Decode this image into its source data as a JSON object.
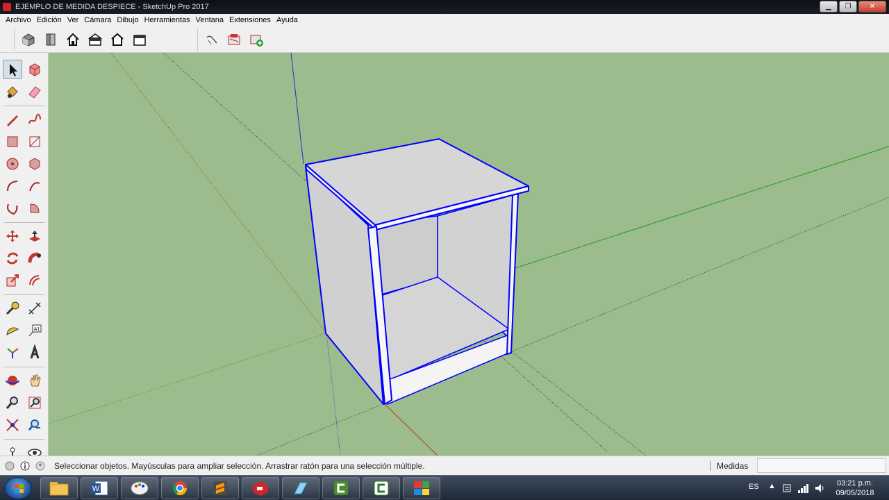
{
  "window": {
    "title": "EJEMPLO DE MEDIDA DESPIECE - SketchUp Pro 2017",
    "controls": {
      "minimize": "▁",
      "maximize": "❐",
      "close": "✕"
    }
  },
  "menu": {
    "items": [
      "Archivo",
      "Edición",
      "Ver",
      "Cámara",
      "Dibujo",
      "Herramientas",
      "Ventana",
      "Extensiones",
      "Ayuda"
    ]
  },
  "toolbar_top": {
    "icons": [
      "iso-view-icon",
      "top-view-icon",
      "home-view-icon",
      "front-view-icon",
      "right-view-icon",
      "back-view-icon",
      "section-plane-icon",
      "warehouse-icon",
      "extension-warehouse-icon"
    ]
  },
  "toolbar_left": {
    "icons": [
      "select-icon",
      "make-component-icon",
      "paint-bucket-icon",
      "eraser-icon",
      "pencil-line-icon",
      "freehand-icon",
      "rectangle-icon",
      "rotated-rectangle-icon",
      "circle-icon",
      "polygon-icon",
      "arc-icon",
      "two-point-arc-icon",
      "three-point-arc-icon",
      "pie-icon",
      "move-icon",
      "push-pull-icon",
      "rotate-icon",
      "follow-me-icon",
      "scale-icon",
      "offset-icon",
      "tape-measure-icon",
      "dimension-icon",
      "protractor-icon",
      "text-icon",
      "axes-icon",
      "3d-text-icon",
      "orbit-icon",
      "pan-icon",
      "zoom-icon",
      "zoom-window-icon",
      "zoom-extents-icon",
      "previous-view-icon",
      "position-camera-icon",
      "look-around-icon"
    ],
    "selected": "select-icon"
  },
  "status": {
    "message": "Seleccionar objetos. Mayúsculas para ampliar selección. Arrastrar ratón para una selección múltiple.",
    "measure_label": "Medidas",
    "measure_value": ""
  },
  "taskbar": {
    "apps": [
      "file-explorer-icon",
      "word-icon",
      "paint-icon",
      "chrome-icon",
      "sublime-icon",
      "sketchup-icon",
      "unknown-app-icon",
      "camtasia-icon",
      "camtasia-recorder-icon",
      "colorful-app-icon"
    ],
    "language": "ES",
    "time": "03:21 p.m.",
    "date": "09/05/2018"
  },
  "colors": {
    "viewport_bg": "#9cbc8e",
    "selection": "#0000ff",
    "axis_red": "#c0392b",
    "axis_green": "#1f9b1f",
    "axis_blue": "#1c2fc8",
    "face": "#d4d4d4"
  }
}
